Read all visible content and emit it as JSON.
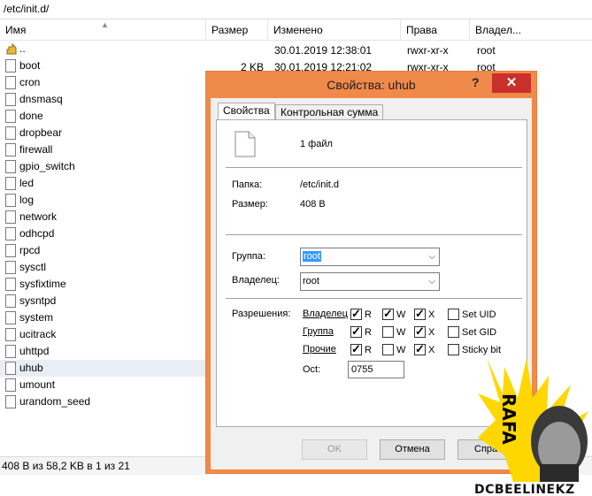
{
  "path": "/etc/init.d/",
  "columns": {
    "name": "Имя",
    "size": "Размер",
    "modified": "Изменено",
    "perms": "Права",
    "owner": "Владел..."
  },
  "files": [
    {
      "name": ".."
    },
    {
      "name": "boot"
    },
    {
      "name": "cron"
    },
    {
      "name": "dnsmasq"
    },
    {
      "name": "done"
    },
    {
      "name": "dropbear"
    },
    {
      "name": "firewall"
    },
    {
      "name": "gpio_switch"
    },
    {
      "name": "led"
    },
    {
      "name": "log"
    },
    {
      "name": "network"
    },
    {
      "name": "odhcpd"
    },
    {
      "name": "rpcd"
    },
    {
      "name": "sysctl"
    },
    {
      "name": "sysfixtime"
    },
    {
      "name": "sysntpd"
    },
    {
      "name": "system"
    },
    {
      "name": "ucitrack"
    },
    {
      "name": "uhttpd"
    },
    {
      "name": "uhub"
    },
    {
      "name": "umount"
    },
    {
      "name": "urandom_seed"
    }
  ],
  "visible_rows": [
    {
      "size": "",
      "modified": "30.01.2019 12:38:01",
      "perms": "rwxr-xr-x",
      "owner": "root"
    },
    {
      "size": "2 KB",
      "modified": "30.01.2019 12:21:02",
      "perms": "rwxr-xr-x",
      "owner": "root"
    }
  ],
  "status": "408 B из 58,2 KB в 1 из 21",
  "dialog": {
    "title": "Свойства: uhub",
    "help": "?",
    "close": "✕",
    "tab_properties": "Свойства",
    "tab_checksum": "Контрольная сумма",
    "file_count": "1 файл",
    "folder_label": "Папка:",
    "folder_value": "/etc/init.d",
    "size_label": "Размер:",
    "size_value": "408 B",
    "group_label": "Группа:",
    "group_value": "root",
    "owner_label": "Владелец:",
    "owner_value": "root",
    "perms_label": "Разрешения:",
    "perm_rows": [
      {
        "who": "Владелец",
        "r": true,
        "w": true,
        "x": true,
        "extra": "Set UID",
        "extra_checked": false
      },
      {
        "who": "Группа",
        "r": true,
        "w": false,
        "x": true,
        "extra": "Set GID",
        "extra_checked": false
      },
      {
        "who": "Прочие",
        "r": true,
        "w": false,
        "x": true,
        "extra": "Sticky bit",
        "extra_checked": false
      }
    ],
    "r": "R",
    "w": "W",
    "x": "X",
    "oct_label": "Oct:",
    "oct_value": "0755",
    "ok": "OK",
    "cancel": "Отмена",
    "apply": "Спра"
  },
  "watermark": {
    "rafa": "RAFA",
    "brand": "DCBEELINEKZ"
  },
  "colors": {
    "dialog_frame": "#ef8a4b",
    "close": "#c9302c",
    "selection": "#3399ff"
  }
}
